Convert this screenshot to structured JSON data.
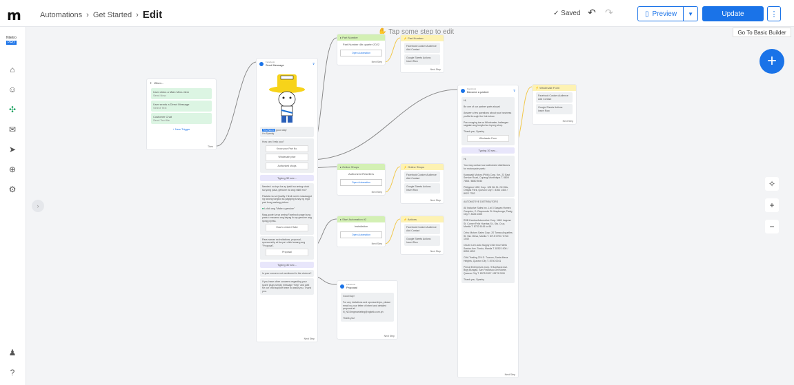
{
  "header": {
    "breadcrumb": [
      "Automations",
      "Get Started"
    ],
    "current": "Edit",
    "saved": "Saved",
    "preview": "Preview",
    "update": "Update",
    "basic_builder": "Go To Basic Builder"
  },
  "sidebar": {
    "brand": "Nitetro",
    "pro": "PRO"
  },
  "canvas": {
    "hint": "Tap some step to edit"
  },
  "when_card": {
    "title": "When...",
    "triggers": [
      {
        "label": "User clicks a Main Menu item",
        "sub": "Send Now"
      },
      {
        "label": "User sends a Direct Message",
        "sub": "Select Text"
      },
      {
        "label": "Customer Chat",
        "sub": "Send Text file"
      }
    ],
    "add": "+ New Trigger",
    "then": "Then"
  },
  "send_card": {
    "channel": "Facebook",
    "title": "Send Message",
    "greeting_tag": "First Name",
    "greeting": "good day!",
    "greeting_sub": "I'm Spanky",
    "question": "How can I help you?",
    "options": [
      "Know your Part No.",
      "Wholesale price",
      "Authorized shops"
    ],
    "typing1": "Typing 30 sec...",
    "para1": "Needed: sa inyo ba ay ipakit sa aming stock sa iyong pasa, genuine ba ang nabili mo?",
    "para2": "Paalala na na Quality: Hindi namin masasagot ng tanong tungkol sa pagiging tunay ng mga part kung walang picture.",
    "check": "I-click ang \"Make a genuine\"",
    "para3": "Mag-quote ka sa aming Facebook page kung pasa o masama ang kapag ito ay genuine ang iyong piyesa.",
    "opt_howto": "How to check if fake",
    "para4": "Para naman sa invitations, proposal, sponsorship at iba pa i-click lamang ang \"Proposal\".",
    "opt_proposal": "Proposal",
    "typing2": "Typing 30 sec...",
    "para5": "Is your concern not mentioned in the choices?",
    "para6": "If you have other concerns regarding your spare plugs simply message \"help\" and wait for our chat support team to assist you. Thank you.",
    "next": "Next Step"
  },
  "part_number": {
    "header": "Part Number",
    "text": "Part Number 4th quarter 2022",
    "button": "Open Automation",
    "next": "Next Step"
  },
  "part_number_actions": {
    "header": "Part Number",
    "a1": "Facebook Custom Audience",
    "a1s": "Add Contact",
    "a2": "Google Sheets Actions",
    "a2s": "Insert Row",
    "next": "Next Step"
  },
  "online_shops": {
    "header": "Online Shops",
    "text": "Authorized Resellers",
    "button": "Open Automation",
    "next": "Next Step"
  },
  "online_shops_actions": {
    "header": "Online Shops",
    "a1": "Facebook Custom Audience",
    "a1s": "Add Contact",
    "a2": "Google Sheets Actions",
    "a2s": "Insert Row",
    "next": "Next Step"
  },
  "start_automation": {
    "header": "Start Automation #2",
    "text": "Installation",
    "button": "Open Automation",
    "next": "Next Step"
  },
  "actions_card": {
    "header": "Actions",
    "a1": "Facebook Custom Audience",
    "a1s": "Add Contact",
    "a2": "Google Sheets Actions",
    "a2s": "Insert Row",
    "next": "Next Step"
  },
  "proposal_card": {
    "channel": "Facebook",
    "title": "Proposal",
    "greet": "Good Day!",
    "body": "For any invitations and sponsorships, please email us your letter of intent and detailed proposal at: N_NGKmgmarketing@ngkntk.com.ph",
    "thanks": "Thank you!",
    "next": "Next Step"
  },
  "partner_card": {
    "channel": "Facebook",
    "title": "Become a partner",
    "hi": "Hi,",
    "p1": "Be one of our partner parts shops!",
    "p2": "Answer a few questions about your business profile through the link below.",
    "p3": "Para maging isa sa Wholesaler, kailangan sagutan ang tungkol sa inyong shop.",
    "thanks": "Thank you, Spanky",
    "wholesale_btn": "Wholesale Form",
    "typing": "Typing 30 sec...",
    "hi2": "Hi,",
    "p4": "You may contact our authorized distributors for motorcycle parts:",
    "d1": "Kawasaki Motors (Phils) Corp. Km. 23 East Service Road, Cupang Muntinlupa T. 8809 7658 / 8850 8940",
    "d2": "Philippine NGK Corp. 128 9th St. Gil Hills, Ortigas Park, Quezon City T. 8364 1460 / 8922 7332",
    "auto_title": "AUTOMOTIVE DISTRIBUTORS",
    "d3": "All Inclusive Sales Inc. Lot 3 Saspan Homes Complex, C. Raymundo St. Maybunga, Pasig City T. 8426 1605",
    "d4": "RSB Harriss Automotive Corp. 1661 Laguna St. Corner Felix Huertas St., Sta. Cruz, Manila T. 8732 6161 to 66",
    "d5": "Cebu Motors Sales Corp. 20 Tomas Arguelles St. Sta. Mesa, Manila T. 8715 0700 / 8716 1040",
    "d6": "Chuen Lien Auto Supply 2310 Inez Nieto Santos Ave. Tondo, Manila T. 8252 1900 / 8253 4252",
    "d7": "CHA Trading 224 D. Tuazon, Santa Mesa Heights, Quezon City T. 8740 0041",
    "d8": "Primal Enterprises Corp. 9 Bonifacio Ave. Brgy Bungad, San Francisco Del Monte, Quezon City T. 8375 2097 / 8373 2099",
    "thanks2": "Thank you, Spanky",
    "next": "Next Step"
  },
  "wholesale_card": {
    "header": "Wholesale Form",
    "a1": "Facebook Custom Audience",
    "a1s": "Add Contact",
    "a2": "Google Sheets Actions",
    "a2s": "Insert Row",
    "next": "Next Step"
  }
}
